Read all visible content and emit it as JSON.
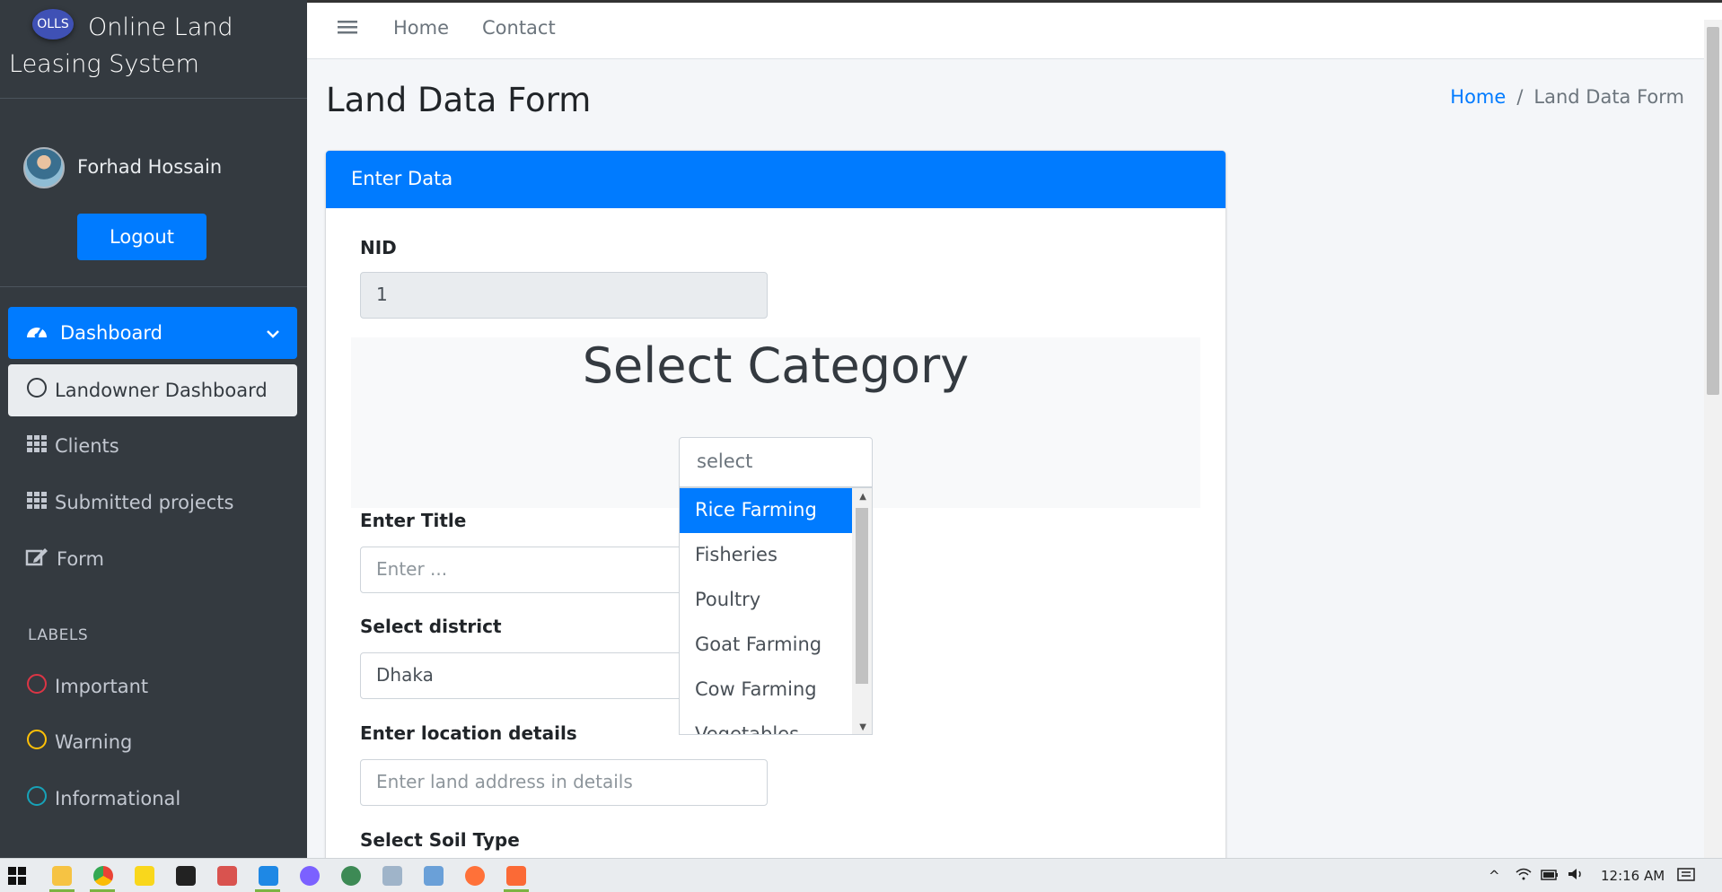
{
  "brand": {
    "logo_text": "OLLS",
    "name": "Online Land Leasing System"
  },
  "user": {
    "name": "Forhad Hossain",
    "logout_label": "Logout"
  },
  "sidebar": {
    "items": [
      {
        "label": "Dashboard"
      },
      {
        "label": "Landowner Dashboard"
      },
      {
        "label": "Clients"
      },
      {
        "label": "Submitted projects"
      },
      {
        "label": "Form"
      }
    ],
    "labels_header": "LABELS",
    "labels": [
      {
        "label": "Important",
        "color": "#dc3545"
      },
      {
        "label": "Warning",
        "color": "#ffc107"
      },
      {
        "label": "Informational",
        "color": "#17a2b8"
      }
    ]
  },
  "topnav": {
    "home": "Home",
    "contact": "Contact"
  },
  "page": {
    "title": "Land Data Form"
  },
  "breadcrumb": {
    "home": "Home",
    "current": "Land Data Form"
  },
  "form": {
    "header": "Enter Data",
    "nid_label": "NID",
    "nid_value": "1",
    "category_title": "Select Category",
    "category_search_placeholder": "select",
    "category_options": [
      "Rice Farming",
      "Fisheries",
      "Poultry",
      "Goat Farming",
      "Cow Farming",
      "Vegetables"
    ],
    "title_label": "Enter Title",
    "title_placeholder": "Enter ...",
    "district_label": "Select district",
    "district_value": "Dhaka",
    "location_label": "Enter location details",
    "location_placeholder": "Enter land address in details",
    "soil_label": "Select Soil Type"
  },
  "taskbar": {
    "time": "12:16 AM"
  },
  "colors": {
    "primary": "#007bff",
    "sidebar": "#343a40"
  }
}
